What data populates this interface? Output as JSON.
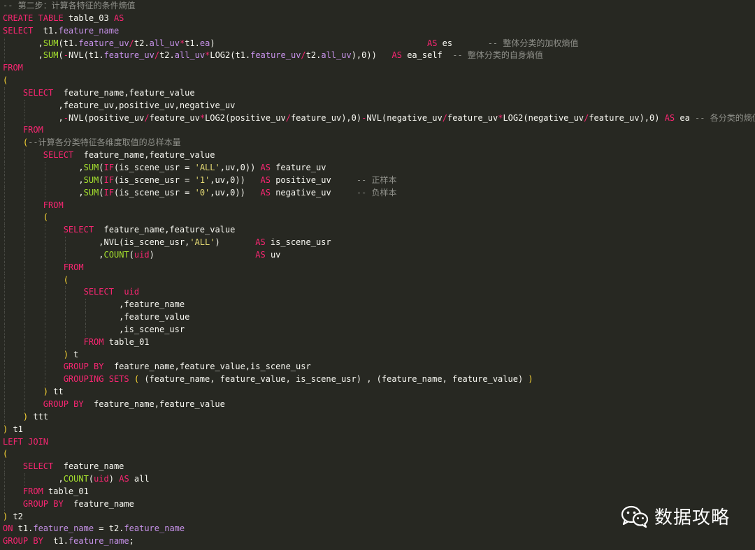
{
  "lines": [
    {
      "indent": 0,
      "tokens": [
        [
          "-- 第二步：计算各特征的条件熵值",
          "cmt"
        ]
      ]
    },
    {
      "indent": 0,
      "tokens": [
        [
          "CREATE TABLE",
          "kw"
        ],
        [
          " table_03 ",
          "plain"
        ],
        [
          "AS",
          "kw"
        ]
      ]
    },
    {
      "indent": 0,
      "tokens": [
        [
          "SELECT",
          "kw"
        ],
        [
          "  t1.",
          "plain"
        ],
        [
          "feature_name",
          "fld"
        ]
      ]
    },
    {
      "indent": 7,
      "tokens": [
        [
          ",",
          "pun"
        ],
        [
          "SUM",
          "fn"
        ],
        [
          "(",
          "pun"
        ],
        [
          "t1.",
          "plain"
        ],
        [
          "feature_uv",
          "fld"
        ],
        [
          "/",
          "op"
        ],
        [
          "t2.",
          "plain"
        ],
        [
          "all_uv",
          "fld"
        ],
        [
          "*",
          "op"
        ],
        [
          "t1.",
          "plain"
        ],
        [
          "ea",
          "fld"
        ],
        [
          ")",
          "pun"
        ],
        [
          "                                          ",
          "plain"
        ],
        [
          "AS",
          "kw"
        ],
        [
          " es       ",
          "plain"
        ],
        [
          "-- 整体分类的加权熵值",
          "cmt"
        ]
      ]
    },
    {
      "indent": 7,
      "tokens": [
        [
          ",",
          "pun"
        ],
        [
          "SUM",
          "fn"
        ],
        [
          "(",
          "pun"
        ],
        [
          "-",
          "op"
        ],
        [
          "NVL",
          "plain"
        ],
        [
          "(",
          "pun"
        ],
        [
          "t1.",
          "plain"
        ],
        [
          "feature_uv",
          "fld"
        ],
        [
          "/",
          "op"
        ],
        [
          "t2.",
          "plain"
        ],
        [
          "all_uv",
          "fld"
        ],
        [
          "*",
          "op"
        ],
        [
          "LOG2",
          "plain"
        ],
        [
          "(",
          "pun"
        ],
        [
          "t1.",
          "plain"
        ],
        [
          "feature_uv",
          "fld"
        ],
        [
          "/",
          "op"
        ],
        [
          "t2.",
          "plain"
        ],
        [
          "all_uv",
          "fld"
        ],
        [
          "),0))",
          "pun"
        ],
        [
          "   ",
          "plain"
        ],
        [
          "AS",
          "kw"
        ],
        [
          " ea_self  ",
          "plain"
        ],
        [
          "-- 整体分类的自身熵值",
          "cmt"
        ]
      ]
    },
    {
      "indent": 0,
      "tokens": [
        [
          "FROM",
          "kw"
        ]
      ]
    },
    {
      "indent": 0,
      "tokens": [
        [
          "(",
          "par"
        ]
      ]
    },
    {
      "indent": 4,
      "tokens": [
        [
          "SELECT",
          "kw"
        ],
        [
          "  feature_name,feature_value",
          "plain"
        ]
      ]
    },
    {
      "indent": 11,
      "tokens": [
        [
          ",feature_uv,positive_uv,negative_uv",
          "plain"
        ]
      ]
    },
    {
      "indent": 11,
      "tokens": [
        [
          ",",
          "pun"
        ],
        [
          "-",
          "op"
        ],
        [
          "NVL",
          "plain"
        ],
        [
          "(",
          "pun"
        ],
        [
          "positive_uv",
          "plain"
        ],
        [
          "/",
          "op"
        ],
        [
          "feature_uv",
          "plain"
        ],
        [
          "*",
          "op"
        ],
        [
          "LOG2",
          "plain"
        ],
        [
          "(",
          "pun"
        ],
        [
          "positive_uv",
          "plain"
        ],
        [
          "/",
          "op"
        ],
        [
          "feature_uv",
          "plain"
        ],
        [
          "),0)",
          "pun"
        ],
        [
          "-",
          "op"
        ],
        [
          "NVL",
          "plain"
        ],
        [
          "(",
          "pun"
        ],
        [
          "negative_uv",
          "plain"
        ],
        [
          "/",
          "op"
        ],
        [
          "feature_uv",
          "plain"
        ],
        [
          "*",
          "op"
        ],
        [
          "LOG2",
          "plain"
        ],
        [
          "(",
          "pun"
        ],
        [
          "negative_uv",
          "plain"
        ],
        [
          "/",
          "op"
        ],
        [
          "feature_uv",
          "plain"
        ],
        [
          "),0) ",
          "pun"
        ],
        [
          "AS",
          "kw"
        ],
        [
          " ea ",
          "plain"
        ],
        [
          "-- 各分类的熵值",
          "cmt"
        ]
      ]
    },
    {
      "indent": 4,
      "tokens": [
        [
          "FROM",
          "kw"
        ]
      ]
    },
    {
      "indent": 4,
      "tokens": [
        [
          "(",
          "par"
        ],
        [
          "--计算各分类特征各维度取值的总样本量",
          "cmt"
        ]
      ]
    },
    {
      "indent": 8,
      "tokens": [
        [
          "SELECT",
          "kw"
        ],
        [
          "  feature_name,feature_value",
          "plain"
        ]
      ]
    },
    {
      "indent": 15,
      "tokens": [
        [
          ",",
          "pun"
        ],
        [
          "SUM",
          "fn"
        ],
        [
          "(",
          "pun"
        ],
        [
          "IF",
          "kw"
        ],
        [
          "(",
          "pun"
        ],
        [
          "is_scene_usr = ",
          "plain"
        ],
        [
          "'ALL'",
          "str"
        ],
        [
          ",uv,0)) ",
          "pun"
        ],
        [
          "AS",
          "kw"
        ],
        [
          " feature_uv",
          "plain"
        ]
      ]
    },
    {
      "indent": 15,
      "tokens": [
        [
          ",",
          "pun"
        ],
        [
          "SUM",
          "fn"
        ],
        [
          "(",
          "pun"
        ],
        [
          "IF",
          "kw"
        ],
        [
          "(",
          "pun"
        ],
        [
          "is_scene_usr = ",
          "plain"
        ],
        [
          "'1'",
          "str"
        ],
        [
          ",uv,0))   ",
          "pun"
        ],
        [
          "AS",
          "kw"
        ],
        [
          " positive_uv     ",
          "plain"
        ],
        [
          "-- 正样本",
          "cmt"
        ]
      ]
    },
    {
      "indent": 15,
      "tokens": [
        [
          ",",
          "pun"
        ],
        [
          "SUM",
          "fn"
        ],
        [
          "(",
          "pun"
        ],
        [
          "IF",
          "kw"
        ],
        [
          "(",
          "pun"
        ],
        [
          "is_scene_usr = ",
          "plain"
        ],
        [
          "'0'",
          "str"
        ],
        [
          ",uv,0))   ",
          "pun"
        ],
        [
          "AS",
          "kw"
        ],
        [
          " negative_uv     ",
          "plain"
        ],
        [
          "-- 负样本",
          "cmt"
        ]
      ]
    },
    {
      "indent": 8,
      "tokens": [
        [
          "FROM",
          "kw"
        ]
      ]
    },
    {
      "indent": 8,
      "tokens": [
        [
          "(",
          "par"
        ]
      ]
    },
    {
      "indent": 12,
      "tokens": [
        [
          "SELECT",
          "kw"
        ],
        [
          "  feature_name,feature_value",
          "plain"
        ]
      ]
    },
    {
      "indent": 19,
      "tokens": [
        [
          ",NVL(is_scene_usr,",
          "plain"
        ],
        [
          "'ALL'",
          "str"
        ],
        [
          ")       ",
          "pun"
        ],
        [
          "AS",
          "kw"
        ],
        [
          " is_scene_usr",
          "plain"
        ]
      ]
    },
    {
      "indent": 19,
      "tokens": [
        [
          ",",
          "pun"
        ],
        [
          "COUNT",
          "fn"
        ],
        [
          "(",
          "pun"
        ],
        [
          "uid",
          "arg"
        ],
        [
          ")                    ",
          "pun"
        ],
        [
          "AS",
          "kw"
        ],
        [
          " uv",
          "plain"
        ]
      ]
    },
    {
      "indent": 12,
      "tokens": [
        [
          "FROM",
          "kw"
        ]
      ]
    },
    {
      "indent": 12,
      "tokens": [
        [
          "(",
          "par"
        ]
      ]
    },
    {
      "indent": 16,
      "tokens": [
        [
          "SELECT",
          "kw"
        ],
        [
          "  ",
          "plain"
        ],
        [
          "uid",
          "arg"
        ]
      ]
    },
    {
      "indent": 23,
      "tokens": [
        [
          ",feature_name",
          "plain"
        ]
      ]
    },
    {
      "indent": 23,
      "tokens": [
        [
          ",feature_value",
          "plain"
        ]
      ]
    },
    {
      "indent": 23,
      "tokens": [
        [
          ",is_scene_usr",
          "plain"
        ]
      ]
    },
    {
      "indent": 16,
      "tokens": [
        [
          "FROM",
          "kw"
        ],
        [
          " table_01",
          "plain"
        ]
      ]
    },
    {
      "indent": 12,
      "tokens": [
        [
          ")",
          "par"
        ],
        [
          " t",
          "plain"
        ]
      ]
    },
    {
      "indent": 12,
      "tokens": [
        [
          "GROUP BY",
          "kw"
        ],
        [
          "  feature_name,feature_value,is_scene_usr",
          "plain"
        ]
      ]
    },
    {
      "indent": 12,
      "tokens": [
        [
          "GROUPING SETS",
          "kw"
        ],
        [
          " ",
          "plain"
        ],
        [
          "(",
          "par"
        ],
        [
          " (feature_name, feature_value, is_scene_usr) , (feature_name, feature_value) ",
          "plain"
        ],
        [
          ")",
          "par"
        ]
      ]
    },
    {
      "indent": 8,
      "tokens": [
        [
          ")",
          "par"
        ],
        [
          " tt",
          "plain"
        ]
      ]
    },
    {
      "indent": 8,
      "tokens": [
        [
          "GROUP BY",
          "kw"
        ],
        [
          "  feature_name,feature_value",
          "plain"
        ]
      ]
    },
    {
      "indent": 4,
      "tokens": [
        [
          ")",
          "par"
        ],
        [
          " ttt",
          "plain"
        ]
      ]
    },
    {
      "indent": 0,
      "tokens": [
        [
          ")",
          "par"
        ],
        [
          " t1",
          "plain"
        ]
      ]
    },
    {
      "indent": 0,
      "tokens": [
        [
          "LEFT JOIN",
          "kw"
        ]
      ]
    },
    {
      "indent": 0,
      "tokens": [
        [
          "(",
          "par"
        ]
      ]
    },
    {
      "indent": 4,
      "tokens": [
        [
          "SELECT",
          "kw"
        ],
        [
          "  feature_name",
          "plain"
        ]
      ]
    },
    {
      "indent": 11,
      "tokens": [
        [
          ",",
          "pun"
        ],
        [
          "COUNT",
          "fn"
        ],
        [
          "(",
          "pun"
        ],
        [
          "uid",
          "arg"
        ],
        [
          ") ",
          "pun"
        ],
        [
          "AS",
          "kw"
        ],
        [
          " all",
          "plain"
        ]
      ]
    },
    {
      "indent": 4,
      "tokens": [
        [
          "FROM",
          "kw"
        ],
        [
          " table_01",
          "plain"
        ]
      ]
    },
    {
      "indent": 4,
      "tokens": [
        [
          "GROUP BY",
          "kw"
        ],
        [
          "  feature_name",
          "plain"
        ]
      ]
    },
    {
      "indent": 0,
      "tokens": [
        [
          ")",
          "par"
        ],
        [
          " t2",
          "plain"
        ]
      ]
    },
    {
      "indent": 0,
      "tokens": [
        [
          "ON",
          "kw"
        ],
        [
          " t1.",
          "plain"
        ],
        [
          "feature_name",
          "fld"
        ],
        [
          " = t2.",
          "plain"
        ],
        [
          "feature_name",
          "fld"
        ]
      ]
    },
    {
      "indent": 0,
      "tokens": [
        [
          "GROUP BY",
          "kw"
        ],
        [
          "  t1.",
          "plain"
        ],
        [
          "feature_name",
          "fld"
        ],
        [
          ";",
          "plain"
        ]
      ]
    }
  ],
  "watermark": {
    "icon": "wechat-icon",
    "text": "数据攻略"
  },
  "colors": {
    "background": "#272822",
    "keyword": "#f92672",
    "function": "#a6e22e",
    "field": "#c792ea",
    "string": "#e6db74",
    "comment": "#8f908a",
    "paren": "#fdd835"
  }
}
